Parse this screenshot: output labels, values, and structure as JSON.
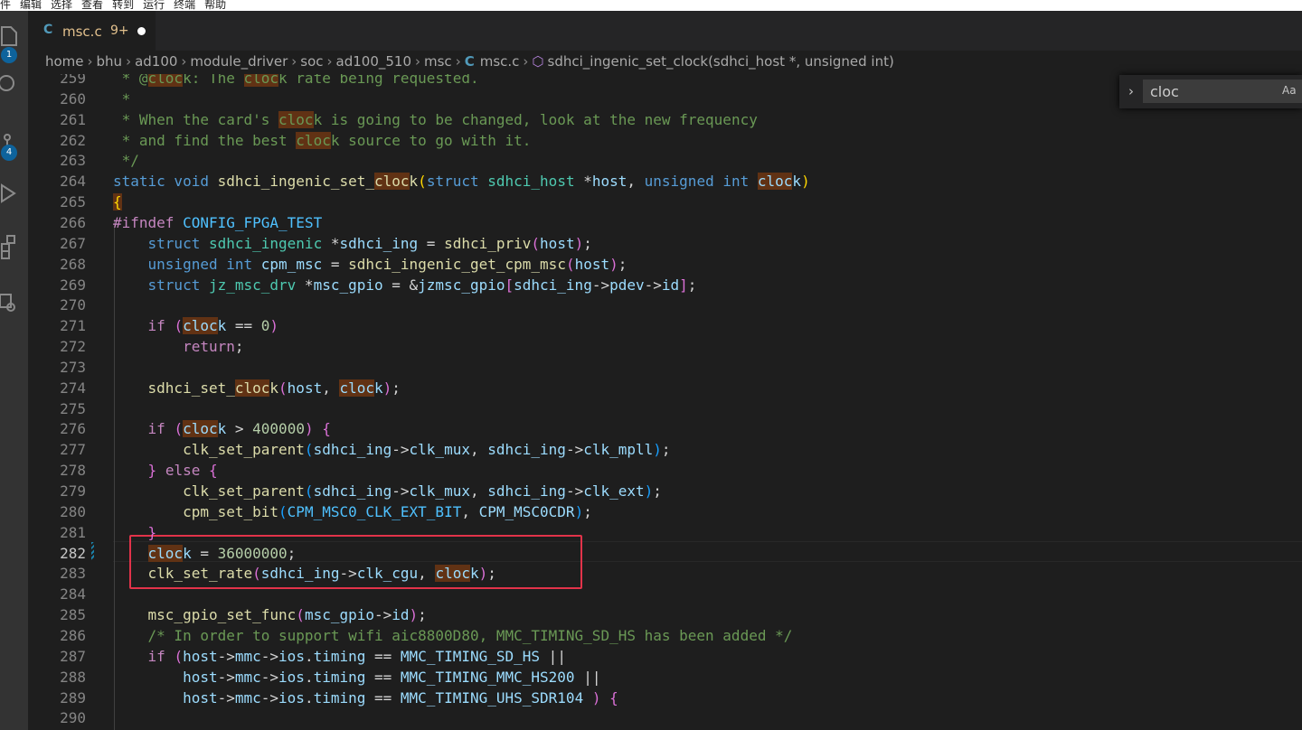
{
  "menu": [
    "件",
    "编辑",
    "选择",
    "查看",
    "转到",
    "运行",
    "终端",
    "帮助"
  ],
  "activity": {
    "explorer_badge": "1",
    "scm_badge": "4"
  },
  "tab": {
    "lang_icon": "C",
    "name": "msc.c",
    "problems": "9+"
  },
  "breadcrumb": {
    "parts": [
      "home",
      "bhu",
      "ad100",
      "module_driver",
      "soc",
      "ad100_510",
      "msc"
    ],
    "file_icon": "C",
    "file": "msc.c",
    "symbol": "sdhci_ingenic_set_clock(sdhci_host *, unsigned int)"
  },
  "find": {
    "value": "cloc",
    "case_label": "Aa"
  },
  "active_line": "282",
  "lines": [
    {
      "n": "259",
      "indent": 0,
      "tokens": [
        [
          "cm",
          " * @"
        ],
        [
          "cm hl",
          "cloc"
        ],
        [
          "cm",
          "k: The "
        ],
        [
          "cm hl",
          "cloc"
        ],
        [
          "cm",
          "k rate being requested."
        ]
      ]
    },
    {
      "n": "260",
      "indent": 0,
      "tokens": [
        [
          "cm",
          " *"
        ]
      ]
    },
    {
      "n": "261",
      "indent": 0,
      "tokens": [
        [
          "cm",
          " * When the card's "
        ],
        [
          "cm hl",
          "cloc"
        ],
        [
          "cm",
          "k is going to be changed, look at the new frequency"
        ]
      ]
    },
    {
      "n": "262",
      "indent": 0,
      "tokens": [
        [
          "cm",
          " * and find the best "
        ],
        [
          "cm hl",
          "cloc"
        ],
        [
          "cm",
          "k source to go with it."
        ]
      ]
    },
    {
      "n": "263",
      "indent": 0,
      "tokens": [
        [
          "cm",
          " */"
        ]
      ]
    },
    {
      "n": "264",
      "indent": 0,
      "tokens": [
        [
          "kw",
          "static"
        ],
        [
          "",
          ""
        ],
        [
          "kw",
          " void"
        ],
        [
          "",
          " "
        ],
        [
          "fn",
          "sdhci_ingenic_set_"
        ],
        [
          "fn hl",
          "cloc"
        ],
        [
          "fn",
          "k"
        ],
        [
          "br1",
          "("
        ],
        [
          "kw",
          "struct"
        ],
        [
          "",
          " "
        ],
        [
          "ty",
          "sdhci_host"
        ],
        [
          "",
          " *"
        ],
        [
          "va",
          "host"
        ],
        [
          "",
          ", "
        ],
        [
          "kw",
          "unsigned"
        ],
        [
          "",
          " "
        ],
        [
          "kw",
          "int"
        ],
        [
          "",
          " "
        ],
        [
          "va hl",
          "cloc"
        ],
        [
          "va",
          "k"
        ],
        [
          "br1",
          ")"
        ]
      ]
    },
    {
      "n": "265",
      "indent": 0,
      "tokens": [
        [
          "br1 hl",
          "{"
        ]
      ]
    },
    {
      "n": "266",
      "indent": 0,
      "tokens": [
        [
          "ct",
          "#ifndef"
        ],
        [
          "",
          " "
        ],
        [
          "mc",
          "CONFIG_FPGA_TEST"
        ]
      ]
    },
    {
      "n": "267",
      "indent": 1,
      "tokens": [
        [
          "kw",
          "struct"
        ],
        [
          "",
          " "
        ],
        [
          "ty",
          "sdhci_ingenic"
        ],
        [
          "",
          " *"
        ],
        [
          "va",
          "sdhci_ing"
        ],
        [
          "",
          " = "
        ],
        [
          "fn",
          "sdhci_priv"
        ],
        [
          "br2",
          "("
        ],
        [
          "va",
          "host"
        ],
        [
          "br2",
          ")"
        ],
        [
          "",
          ";"
        ]
      ]
    },
    {
      "n": "268",
      "indent": 1,
      "tokens": [
        [
          "kw",
          "unsigned"
        ],
        [
          "",
          " "
        ],
        [
          "kw",
          "int"
        ],
        [
          "",
          " "
        ],
        [
          "va",
          "cpm_msc"
        ],
        [
          "",
          " = "
        ],
        [
          "fn",
          "sdhci_ingenic_get_cpm_msc"
        ],
        [
          "br2",
          "("
        ],
        [
          "va",
          "host"
        ],
        [
          "br2",
          ")"
        ],
        [
          "",
          ";"
        ]
      ]
    },
    {
      "n": "269",
      "indent": 1,
      "tokens": [
        [
          "kw",
          "struct"
        ],
        [
          "",
          " "
        ],
        [
          "ty",
          "jz_msc_drv"
        ],
        [
          "",
          " *"
        ],
        [
          "va",
          "msc_gpio"
        ],
        [
          "",
          " = &"
        ],
        [
          "va",
          "jzmsc_gpio"
        ],
        [
          "br2",
          "["
        ],
        [
          "va",
          "sdhci_ing"
        ],
        [
          "",
          "->"
        ],
        [
          "va",
          "pdev"
        ],
        [
          "",
          "->"
        ],
        [
          "va",
          "id"
        ],
        [
          "br2",
          "]"
        ],
        [
          "",
          ";"
        ]
      ]
    },
    {
      "n": "270",
      "indent": 1,
      "tokens": []
    },
    {
      "n": "271",
      "indent": 1,
      "tokens": [
        [
          "ct",
          "if"
        ],
        [
          "",
          " "
        ],
        [
          "br2",
          "("
        ],
        [
          "va hl",
          "cloc"
        ],
        [
          "va",
          "k"
        ],
        [
          "",
          " == "
        ],
        [
          "nu",
          "0"
        ],
        [
          "br2",
          ")"
        ]
      ]
    },
    {
      "n": "272",
      "indent": 2,
      "tokens": [
        [
          "ct",
          "return"
        ],
        [
          "",
          ";"
        ]
      ]
    },
    {
      "n": "273",
      "indent": 1,
      "tokens": []
    },
    {
      "n": "274",
      "indent": 1,
      "tokens": [
        [
          "fn",
          "sdhci_set_"
        ],
        [
          "fn hl",
          "cloc"
        ],
        [
          "fn",
          "k"
        ],
        [
          "br2",
          "("
        ],
        [
          "va",
          "host"
        ],
        [
          "",
          ", "
        ],
        [
          "va hl",
          "cloc"
        ],
        [
          "va",
          "k"
        ],
        [
          "br2",
          ")"
        ],
        [
          "",
          ";"
        ]
      ]
    },
    {
      "n": "275",
      "indent": 1,
      "tokens": []
    },
    {
      "n": "276",
      "indent": 1,
      "tokens": [
        [
          "ct",
          "if"
        ],
        [
          "",
          " "
        ],
        [
          "br2",
          "("
        ],
        [
          "va hl",
          "cloc"
        ],
        [
          "va",
          "k"
        ],
        [
          "",
          " > "
        ],
        [
          "nu",
          "400000"
        ],
        [
          "br2",
          ")"
        ],
        [
          "",
          " "
        ],
        [
          "br2",
          "{"
        ]
      ]
    },
    {
      "n": "277",
      "indent": 2,
      "tokens": [
        [
          "fn",
          "clk_set_parent"
        ],
        [
          "br3",
          "("
        ],
        [
          "va",
          "sdhci_ing"
        ],
        [
          "",
          "->"
        ],
        [
          "va",
          "clk_mux"
        ],
        [
          "",
          ", "
        ],
        [
          "va",
          "sdhci_ing"
        ],
        [
          "",
          "->"
        ],
        [
          "va",
          "clk_mpll"
        ],
        [
          "br3",
          ")"
        ],
        [
          "",
          ";"
        ]
      ]
    },
    {
      "n": "278",
      "indent": 1,
      "tokens": [
        [
          "br2",
          "}"
        ],
        [
          "",
          " "
        ],
        [
          "ct",
          "else"
        ],
        [
          "",
          " "
        ],
        [
          "br2",
          "{"
        ]
      ]
    },
    {
      "n": "279",
      "indent": 2,
      "tokens": [
        [
          "fn",
          "clk_set_parent"
        ],
        [
          "br3",
          "("
        ],
        [
          "va",
          "sdhci_ing"
        ],
        [
          "",
          "->"
        ],
        [
          "va",
          "clk_mux"
        ],
        [
          "",
          ", "
        ],
        [
          "va",
          "sdhci_ing"
        ],
        [
          "",
          "->"
        ],
        [
          "va",
          "clk_ext"
        ],
        [
          "br3",
          ")"
        ],
        [
          "",
          ";"
        ]
      ]
    },
    {
      "n": "280",
      "indent": 2,
      "tokens": [
        [
          "fn",
          "cpm_set_bit"
        ],
        [
          "br3",
          "("
        ],
        [
          "mc",
          "CPM_MSC0_CLK_EXT_BIT"
        ],
        [
          "",
          ", "
        ],
        [
          "va",
          "CPM_MSC0CDR"
        ],
        [
          "br3",
          ")"
        ],
        [
          "",
          ";"
        ]
      ]
    },
    {
      "n": "281",
      "indent": 1,
      "tokens": [
        [
          "br2",
          "}"
        ]
      ]
    },
    {
      "n": "282",
      "indent": 1,
      "tokens": [
        [
          "va hl",
          "cloc"
        ],
        [
          "va",
          "k"
        ],
        [
          "",
          " = "
        ],
        [
          "nu",
          "36000000"
        ],
        [
          "",
          ";"
        ]
      ]
    },
    {
      "n": "283",
      "indent": 1,
      "tokens": [
        [
          "fn",
          "clk_set_rate"
        ],
        [
          "br2",
          "("
        ],
        [
          "va",
          "sdhci_ing"
        ],
        [
          "",
          "->"
        ],
        [
          "va",
          "clk_cgu"
        ],
        [
          "",
          ", "
        ],
        [
          "va hl",
          "cloc"
        ],
        [
          "va",
          "k"
        ],
        [
          "br2",
          ")"
        ],
        [
          "",
          ";"
        ]
      ]
    },
    {
      "n": "284",
      "indent": 1,
      "tokens": []
    },
    {
      "n": "285",
      "indent": 1,
      "tokens": [
        [
          "fn",
          "msc_gpio_set_func"
        ],
        [
          "br2",
          "("
        ],
        [
          "va",
          "msc_gpio"
        ],
        [
          "",
          "->"
        ],
        [
          "va",
          "id"
        ],
        [
          "br2",
          ")"
        ],
        [
          "",
          ";"
        ]
      ]
    },
    {
      "n": "286",
      "indent": 1,
      "tokens": [
        [
          "cm",
          "/* In order to support wifi aic8800D80, MMC_TIMING_SD_HS has been added */"
        ]
      ]
    },
    {
      "n": "287",
      "indent": 1,
      "tokens": [
        [
          "ct",
          "if"
        ],
        [
          "",
          " "
        ],
        [
          "br2",
          "("
        ],
        [
          "va",
          "host"
        ],
        [
          "",
          "->"
        ],
        [
          "va",
          "mmc"
        ],
        [
          "",
          "->"
        ],
        [
          "va",
          "ios"
        ],
        [
          "",
          "."
        ],
        [
          "va",
          "timing"
        ],
        [
          "",
          " == "
        ],
        [
          "va",
          "MMC_TIMING_SD_HS"
        ],
        [
          "",
          " ||"
        ]
      ]
    },
    {
      "n": "288",
      "indent": 2,
      "tokens": [
        [
          "va",
          "host"
        ],
        [
          "",
          "->"
        ],
        [
          "va",
          "mmc"
        ],
        [
          "",
          "->"
        ],
        [
          "va",
          "ios"
        ],
        [
          "",
          "."
        ],
        [
          "va",
          "timing"
        ],
        [
          "",
          " == "
        ],
        [
          "va",
          "MMC_TIMING_MMC_HS200"
        ],
        [
          "",
          " ||"
        ]
      ]
    },
    {
      "n": "289",
      "indent": 2,
      "tokens": [
        [
          "va",
          "host"
        ],
        [
          "",
          "->"
        ],
        [
          "va",
          "mmc"
        ],
        [
          "",
          "->"
        ],
        [
          "va",
          "ios"
        ],
        [
          "",
          "."
        ],
        [
          "va",
          "timing"
        ],
        [
          "",
          " == "
        ],
        [
          "va",
          "MMC_TIMING_UHS_SDR104"
        ],
        [
          "",
          " "
        ],
        [
          "br2",
          ")"
        ],
        [
          "",
          " "
        ],
        [
          "br2",
          "{"
        ]
      ]
    },
    {
      "n": "290",
      "indent": 1,
      "tokens": []
    }
  ]
}
